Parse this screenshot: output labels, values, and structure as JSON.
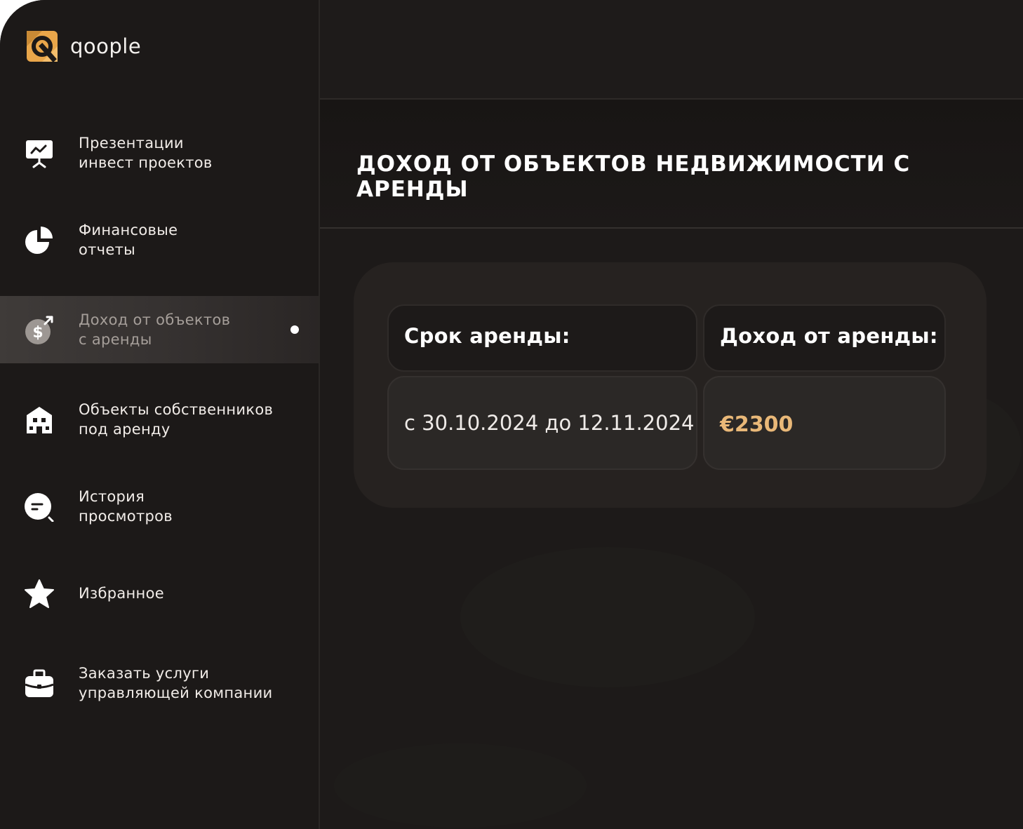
{
  "brand": {
    "name": "qoople",
    "accent_color": "#e9a64a"
  },
  "sidebar": {
    "items": [
      {
        "label": "Презентации\nинвест проектов",
        "icon": "presentation-board-icon",
        "active": false
      },
      {
        "label": "Финансовые\nотчеты",
        "icon": "pie-chart-icon",
        "active": false
      },
      {
        "label": "Доход от объектов\nс аренды",
        "icon": "dollar-growth-icon",
        "active": true
      },
      {
        "label": "Объекты собственников\nпод аренду",
        "icon": "building-icon",
        "active": false
      },
      {
        "label": "История\nпросмотров",
        "icon": "chat-search-icon",
        "active": false
      },
      {
        "label": "Избранное",
        "icon": "star-icon",
        "active": false
      },
      {
        "label": "Заказать услуги\nуправляющей компании",
        "icon": "briefcase-icon",
        "active": false
      }
    ]
  },
  "main": {
    "title": "ДОХОД ОТ ОБЪЕКТОВ НЕДВИЖИМОСТИ С АРЕНДЫ",
    "table": {
      "headers": [
        "Срок аренды:",
        "Доход от аренды:"
      ],
      "row": {
        "period": "с 30.10.2024 до 12.11.2024",
        "income": "€2300"
      }
    }
  }
}
